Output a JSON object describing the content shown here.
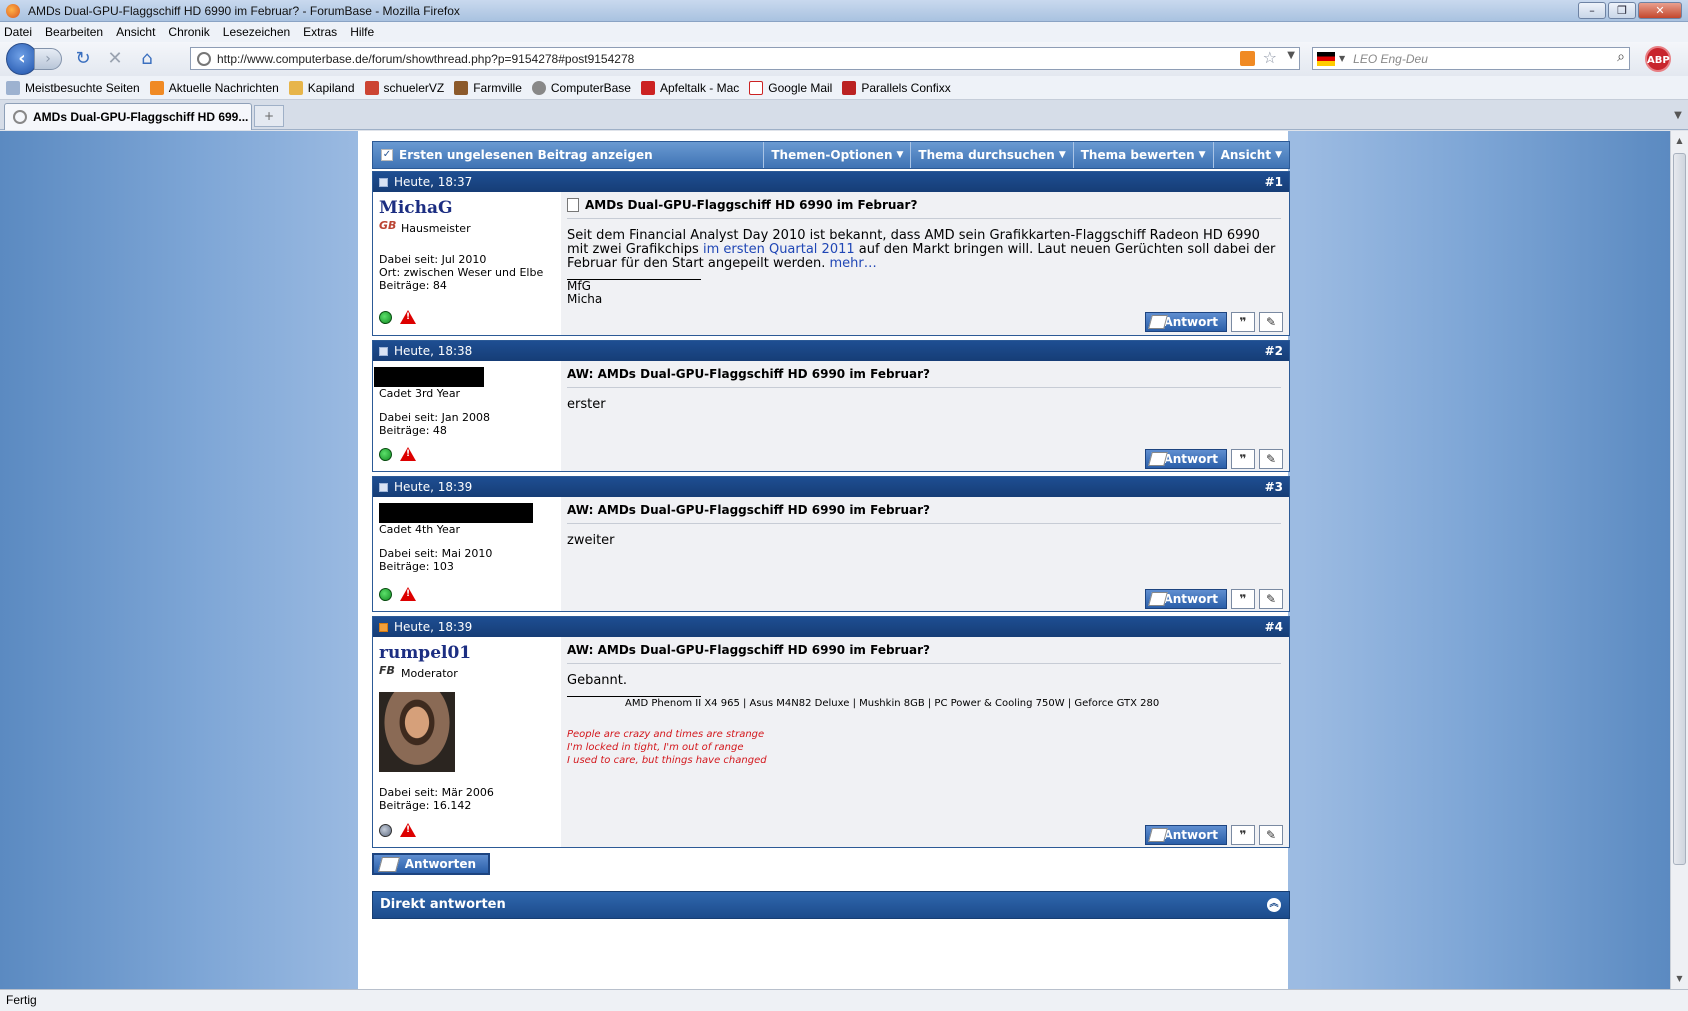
{
  "window": {
    "title": "AMDs Dual-GPU-Flaggschiff HD 6990 im Februar? - ForumBase - Mozilla Firefox"
  },
  "menu": [
    "Datei",
    "Bearbeiten",
    "Ansicht",
    "Chronik",
    "Lesezeichen",
    "Extras",
    "Hilfe"
  ],
  "nav": {
    "url": "http://www.computerbase.de/forum/showthread.php?p=9154278#post9154278",
    "search_placeholder": "LEO Eng-Deu",
    "abp": "ABP"
  },
  "bookmarks": [
    "Meistbesuchte Seiten",
    "Aktuelle Nachrichten",
    "Kapiland",
    "schuelerVZ",
    "Farmville",
    "ComputerBase",
    "Apfeltalk - Mac",
    "Google Mail",
    "Parallels Confixx"
  ],
  "tab": {
    "label": "AMDs Dual-GPU-Flaggschiff HD 699..."
  },
  "thread_toolbar": {
    "first_unread": "Ersten ungelesenen Beitrag anzeigen",
    "options": [
      "Themen-Optionen",
      "Thema durchsuchen",
      "Thema bewerten",
      "Ansicht"
    ]
  },
  "posts": [
    {
      "time": "Heute, 18:37",
      "num": "#1",
      "user": "MichaG",
      "rank": "Hausmeister",
      "joined": "Dabei seit: Jul 2010",
      "location": "Ort: zwischen Weser und Elbe",
      "posts": "Beiträge: 84",
      "title": "AMDs Dual-GPU-Flaggschiff HD 6990 im Februar?",
      "body_1": "Seit dem Financial Analyst Day 2010 ist bekannt, dass AMD sein Grafikkarten-Flaggschiff Radeon HD 6990 mit zwei Grafikchips ",
      "body_link": "im ersten Quartal 2011",
      "body_2": " auf den Markt bringen will. Laut neuen Gerüchten soll dabei der Februar für den Start angepeilt werden. ",
      "more": "mehr…",
      "sig_1": "MfG",
      "sig_2": "Micha"
    },
    {
      "time": "Heute, 18:38",
      "num": "#2",
      "rank": "Cadet 3rd Year",
      "joined": "Dabei seit: Jan 2008",
      "posts": "Beiträge: 48",
      "title": "AW: AMDs Dual-GPU-Flaggschiff HD 6990 im Februar?",
      "body": "erster"
    },
    {
      "time": "Heute, 18:39",
      "num": "#3",
      "rank": "Cadet 4th Year",
      "joined": "Dabei seit: Mai 2010",
      "posts": "Beiträge: 103",
      "title": "AW: AMDs Dual-GPU-Flaggschiff HD 6990 im Februar?",
      "body": "zweiter"
    },
    {
      "time": "Heute, 18:39",
      "num": "#4",
      "user": "rumpel01",
      "rank": "Moderator",
      "joined": "Dabei seit: Mär 2006",
      "posts": "Beiträge: 16.142",
      "title": "AW: AMDs Dual-GPU-Flaggschiff HD 6990 im Februar?",
      "body": "Gebannt.",
      "sig_hw": "AMD Phenom II X4 965 | Asus M4N82 Deluxe | Mushkin 8GB | PC Power & Cooling 750W | Geforce GTX 280",
      "sig_lines": [
        "People are crazy and times are strange",
        "I'm locked in tight, I'm out of range",
        "I used to care, but things have changed"
      ]
    }
  ],
  "buttons": {
    "antwort": "Antwort",
    "antworten": "Antworten",
    "quote": "❞"
  },
  "direkt": "Direkt antworten",
  "status": "Fertig"
}
